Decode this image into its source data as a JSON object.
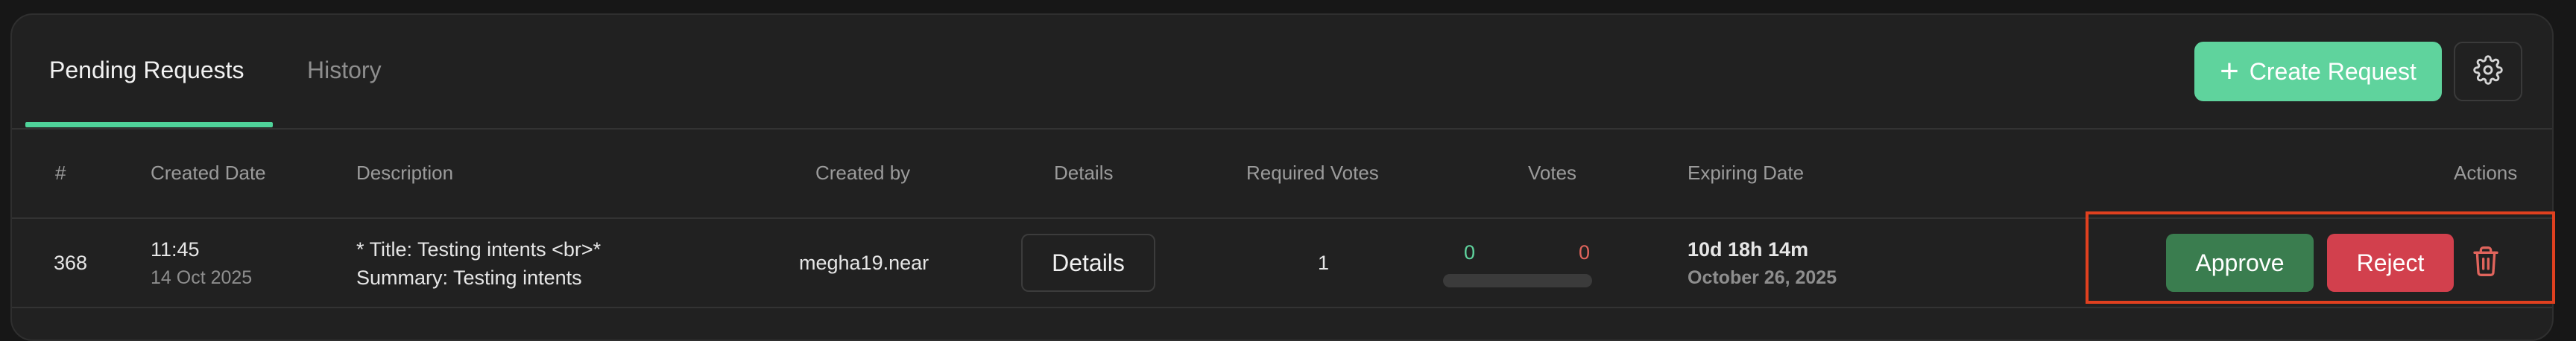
{
  "tabs": [
    {
      "label": "Pending Requests",
      "active": true
    },
    {
      "label": "History",
      "active": false
    }
  ],
  "toolbar": {
    "create_label": "Create Request",
    "plus_icon": "plus-icon",
    "settings_icon": "gear-icon"
  },
  "table": {
    "headers": {
      "id": "#",
      "created_date": "Created Date",
      "description": "Description",
      "created_by": "Created by",
      "details": "Details",
      "required_votes": "Required Votes",
      "votes": "Votes",
      "expiring_date": "Expiring Date",
      "actions": "Actions"
    },
    "rows": [
      {
        "id": "368",
        "time": "11:45",
        "date": "14 Oct 2025",
        "description_line1": "* Title: Testing intents <br>*",
        "description_line2": "Summary: Testing intents",
        "created_by": "megha19.near",
        "details_label": "Details",
        "required_votes": "1",
        "votes_for": "0",
        "votes_against": "0",
        "expiring_relative": "10d 18h 14m",
        "expiring_date": "October 26, 2025",
        "approve_label": "Approve",
        "reject_label": "Reject",
        "delete_icon": "trash-icon"
      }
    ]
  },
  "colors": {
    "accent": "#5fd39d",
    "approve": "#3a7d4f",
    "reject": "#d2404d",
    "vote_for": "#5fd39d",
    "vote_against": "#e0645c",
    "highlight": "#e0401f"
  }
}
